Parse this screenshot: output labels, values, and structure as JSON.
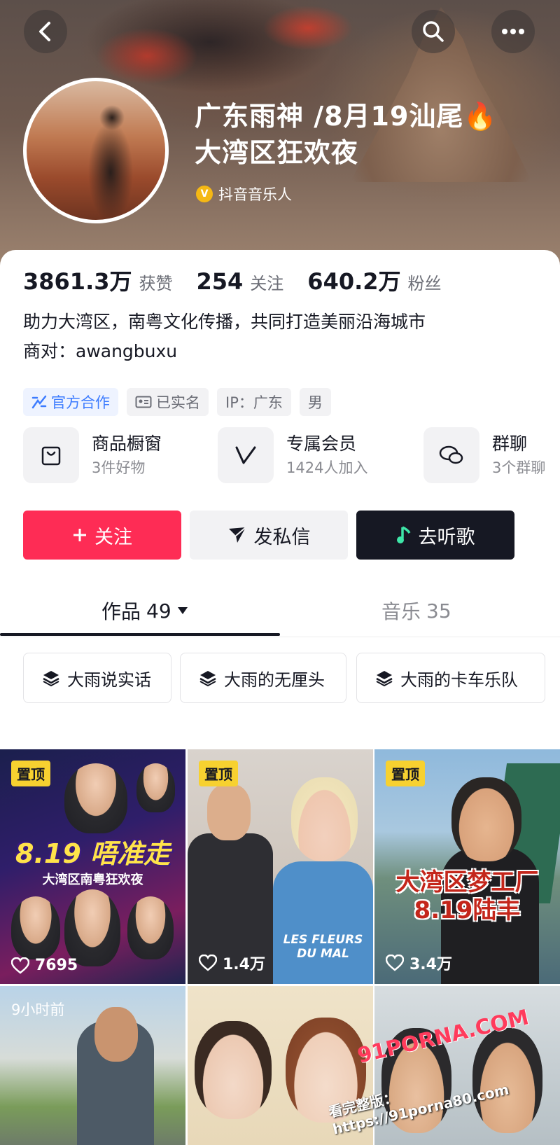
{
  "header": {
    "nickname_line1": "广东雨神 /8月19汕尾🔥",
    "nickname_line2": "大湾区狂欢夜",
    "verify_badge": "V",
    "verify_text": "抖音音乐人"
  },
  "stats": [
    {
      "value": "3861.3万",
      "label": "获赞"
    },
    {
      "value": "254",
      "label": "关注"
    },
    {
      "value": "640.2万",
      "label": "粉丝"
    }
  ],
  "bio": {
    "line1": "助力大湾区，南粤文化传播，共同打造美丽沿海城市",
    "line2": "商对：awangbuxu"
  },
  "tags": [
    "官方合作",
    "已实名",
    "IP：广东",
    "男"
  ],
  "shortcuts": [
    {
      "title": "商品橱窗",
      "sub": "3件好物",
      "icon": "bag-icon"
    },
    {
      "title": "专属会员",
      "sub": "1424人加入",
      "icon": "v-icon"
    },
    {
      "title": "群聊",
      "sub": "3个群聊",
      "icon": "chat-icon"
    }
  ],
  "actions": {
    "follow": "关注",
    "message": "发私信",
    "listen": "去听歌"
  },
  "tabs": {
    "works_label": "作品",
    "works_count": "49",
    "music_label": "音乐",
    "music_count": "35"
  },
  "collections": [
    "大雨说实话",
    "大雨的无厘头",
    "大雨的卡车乐队"
  ],
  "videos": [
    {
      "badge": "置顶",
      "likes": "7695",
      "caption": "8.19 唔准走",
      "sub": "大湾区南粤狂欢夜"
    },
    {
      "badge": "置顶",
      "likes": "1.4万",
      "caption": "",
      "sub": "LES FLEURS DU MAL"
    },
    {
      "badge": "置顶",
      "likes": "3.4万",
      "caption": "大湾区梦工厂\n8.19陆丰",
      "sub": ""
    },
    {
      "badge": "9小时前",
      "likes": "",
      "caption": "",
      "sub": ""
    },
    {
      "badge": "",
      "likes": "",
      "caption": "",
      "sub": ""
    },
    {
      "badge": "",
      "likes": "",
      "caption": "",
      "sub": ""
    }
  ],
  "watermark": {
    "domain": "91PORNA.COM",
    "url": "看完整版：https://91porna80.com"
  },
  "colors": {
    "accent": "#fe2c55",
    "pin_badge": "#f7d130",
    "official_blue": "#3d7cff",
    "dark_button": "#161823"
  }
}
